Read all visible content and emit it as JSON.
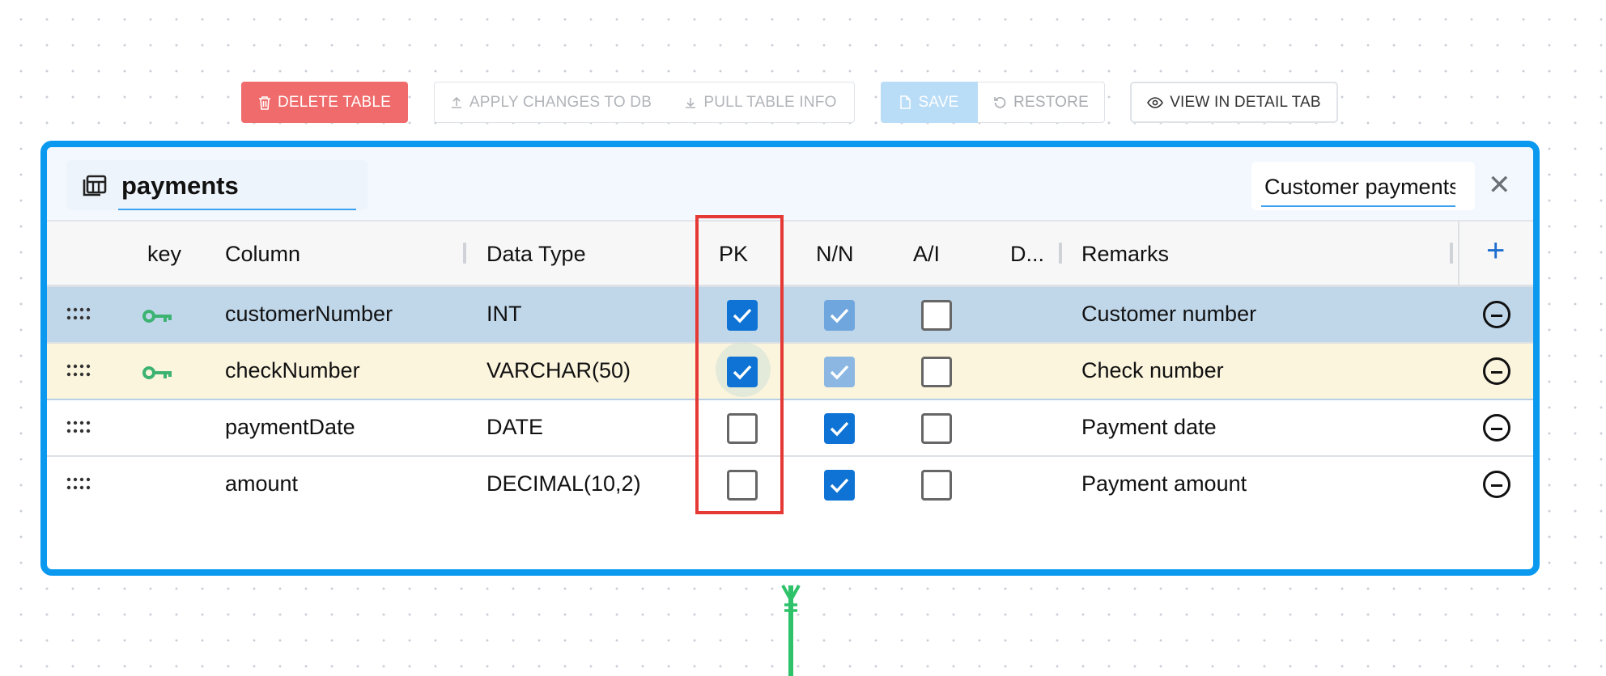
{
  "toolbar": {
    "delete_label": "DELETE TABLE",
    "apply_label": "APPLY CHANGES TO DB",
    "pull_label": "PULL TABLE INFO",
    "save_label": "SAVE",
    "restore_label": "RESTORE",
    "detail_label": "VIEW IN DETAIL TAB"
  },
  "table": {
    "name": "payments",
    "remark": "Customer payments"
  },
  "columns_header": {
    "key": "key",
    "column": "Column",
    "data_type": "Data Type",
    "pk": "PK",
    "nn": "N/N",
    "ai": "A/I",
    "default": "D...",
    "remarks": "Remarks"
  },
  "rows": [
    {
      "is_key": true,
      "column": "customerNumber",
      "data_type": "INT",
      "pk": true,
      "nn": true,
      "ai": false,
      "default": "",
      "remarks": "Customer number"
    },
    {
      "is_key": true,
      "column": "checkNumber",
      "data_type": "VARCHAR(50)",
      "pk": true,
      "nn": true,
      "ai": false,
      "default": "",
      "remarks": "Check number"
    },
    {
      "is_key": false,
      "column": "paymentDate",
      "data_type": "DATE",
      "pk": false,
      "nn": true,
      "ai": false,
      "default": "",
      "remarks": "Payment date"
    },
    {
      "is_key": false,
      "column": "amount",
      "data_type": "DECIMAL(10,2)",
      "pk": false,
      "nn": true,
      "ai": false,
      "default": "",
      "remarks": "Payment amount"
    }
  ],
  "colors": {
    "accent": "#0b99f0",
    "delete": "#f06b6b",
    "key_icon": "#3cb371",
    "checkbox": "#0e73d4",
    "highlight": "#e53935",
    "relation": "#2ec26a"
  },
  "icons": {
    "delete": "trash-icon",
    "apply": "upload-icon",
    "pull": "download-icon",
    "save": "file-icon",
    "restore": "restore-icon",
    "detail": "eye-icon",
    "table": "table-icon",
    "key": "key-icon",
    "drag": "drag-handle-icon",
    "add": "plus-icon",
    "remove": "minus-circle-icon",
    "close": "close-icon"
  }
}
